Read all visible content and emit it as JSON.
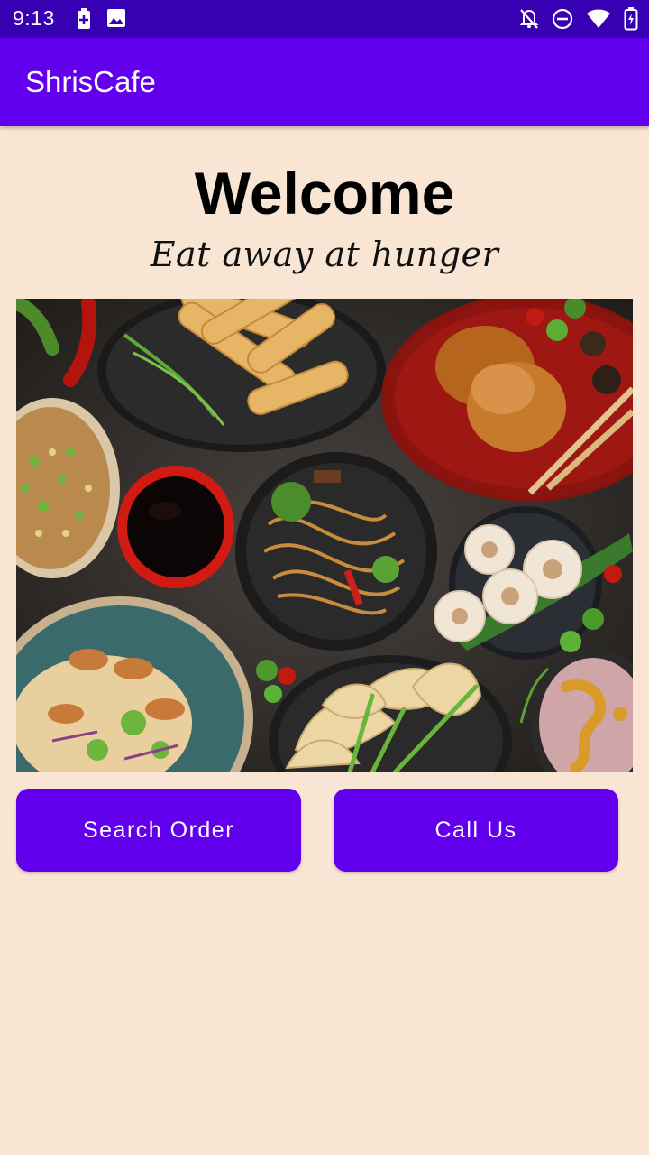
{
  "status_bar": {
    "time": "9:13",
    "icons": [
      "battery-charging-icon",
      "image-icon",
      "notifications-off-icon",
      "do-not-disturb-icon",
      "wifi-icon",
      "battery-icon"
    ]
  },
  "app_bar": {
    "title": "ShrisCafe"
  },
  "main": {
    "heading": "Welcome",
    "tagline": "Eat away at hunger",
    "buttons": {
      "search_order": "Search Order",
      "call_us": "Call Us"
    }
  },
  "colors": {
    "status_bar": "#3700b3",
    "primary": "#6200ee",
    "background": "#f8e5d3"
  }
}
